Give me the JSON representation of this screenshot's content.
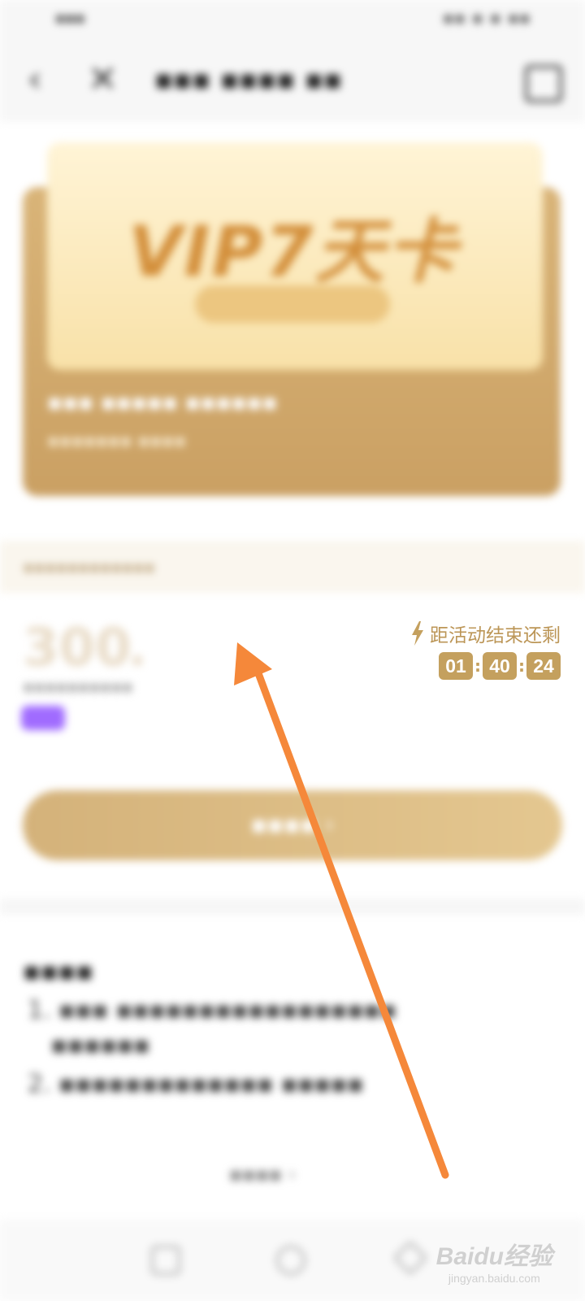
{
  "activity": {
    "countdown_label": "距活动结束还剩",
    "countdown": {
      "hours": "01",
      "minutes": "40",
      "seconds": "24",
      "separator": ":"
    }
  },
  "card": {
    "title": "VIP7天卡"
  },
  "price": {
    "value": "300"
  },
  "watermark": {
    "brand": "Baidu经验",
    "url": "jingyan.baidu.com"
  },
  "colors": {
    "gold_accent": "#c4a05e",
    "arrow_annotation": "#f5883a",
    "card_gold": "#d9b478"
  },
  "icons": {
    "back": "chevron-left",
    "close": "close-x",
    "bolt": "lightning-bolt"
  }
}
